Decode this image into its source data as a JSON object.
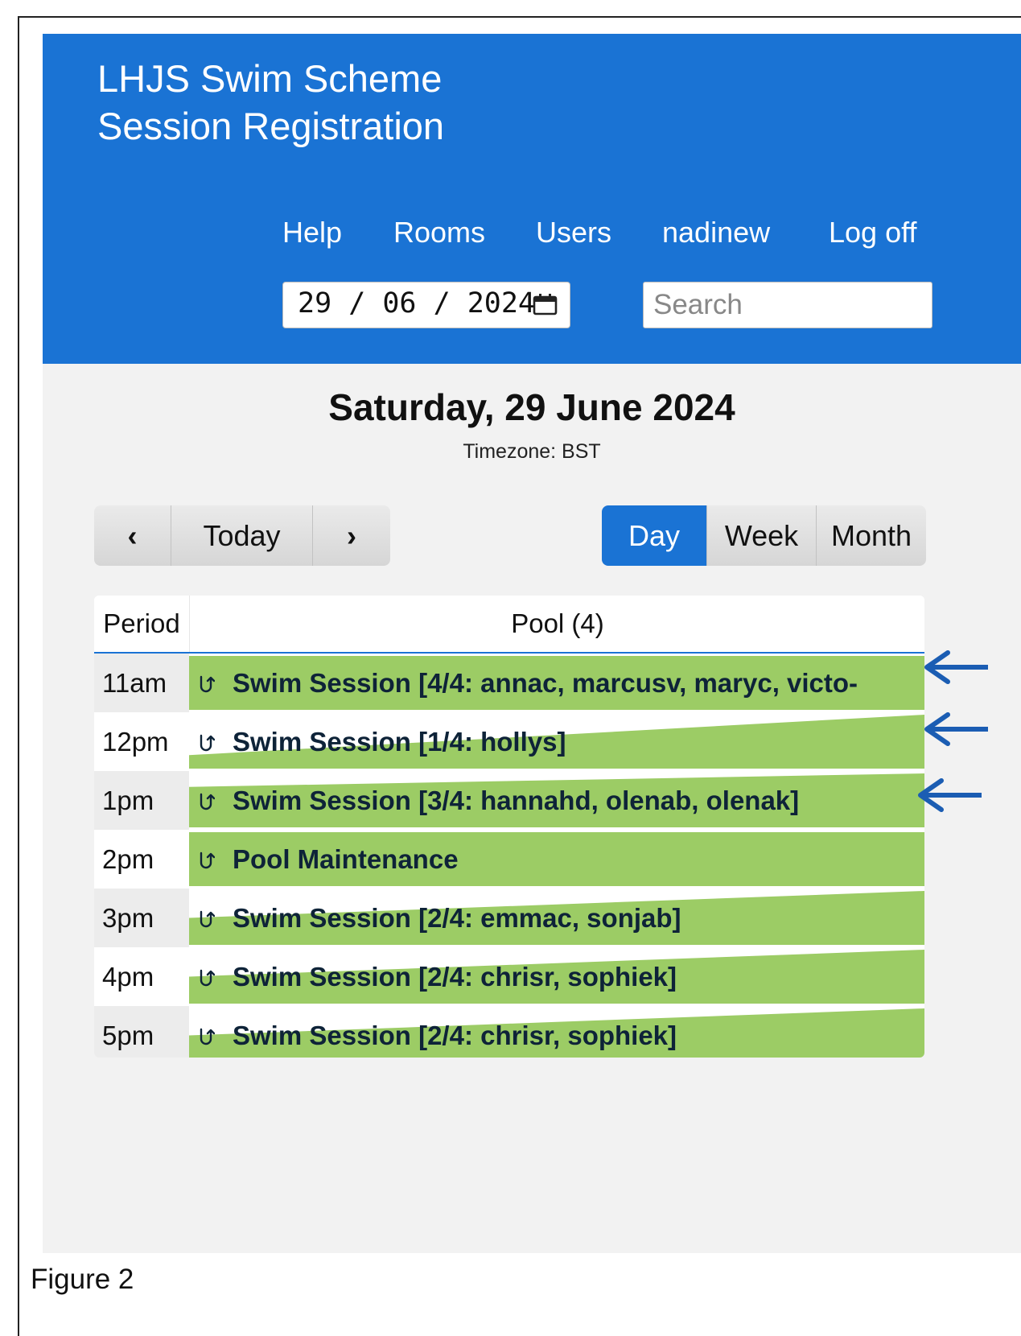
{
  "app": {
    "title_line1": "LHJS Swim Scheme",
    "title_line2": "Session Registration"
  },
  "nav": {
    "help": "Help",
    "rooms": "Rooms",
    "users": "Users",
    "username": "nadinew",
    "logoff": "Log off"
  },
  "date_input": {
    "value": "29 / 06 / 2024",
    "icon": "calendar-icon"
  },
  "search": {
    "placeholder": "Search"
  },
  "page": {
    "date_heading": "Saturday, 29 June 2024",
    "timezone": "Timezone: BST"
  },
  "controls": {
    "prev": "‹",
    "today": "Today",
    "next": "›",
    "day": "Day",
    "week": "Week",
    "month": "Month",
    "active_view": "Day"
  },
  "grid": {
    "period_header": "Period",
    "room_header": "Pool (4)",
    "rows": [
      {
        "period": "11am",
        "entry": "Swim Session [4/4: annac, marcusv, maryc, victo-",
        "fill": 1.0
      },
      {
        "period": "12pm",
        "entry": "Swim Session [1/4: hollys]",
        "fill": 0.25
      },
      {
        "period": "1pm",
        "entry": "Swim Session [3/4: hannahd, olenab, olenak]",
        "fill": 0.75
      },
      {
        "period": "2pm",
        "entry": "Pool Maintenance",
        "fill": 1.0
      },
      {
        "period": "3pm",
        "entry": "Swim Session [2/4: emmac, sonjab]",
        "fill": 0.5
      },
      {
        "period": "4pm",
        "entry": "Swim Session [2/4: chrisr, sophiek]",
        "fill": 0.5
      },
      {
        "period": "5pm",
        "entry": "Swim Session [2/4: chrisr, sophiek]",
        "fill": 0.5
      }
    ]
  },
  "colors": {
    "header_blue": "#1a73d4",
    "booking_green": "#9ccc65",
    "annotation_arrow": "#1b5db3"
  },
  "caption": "Figure 2"
}
